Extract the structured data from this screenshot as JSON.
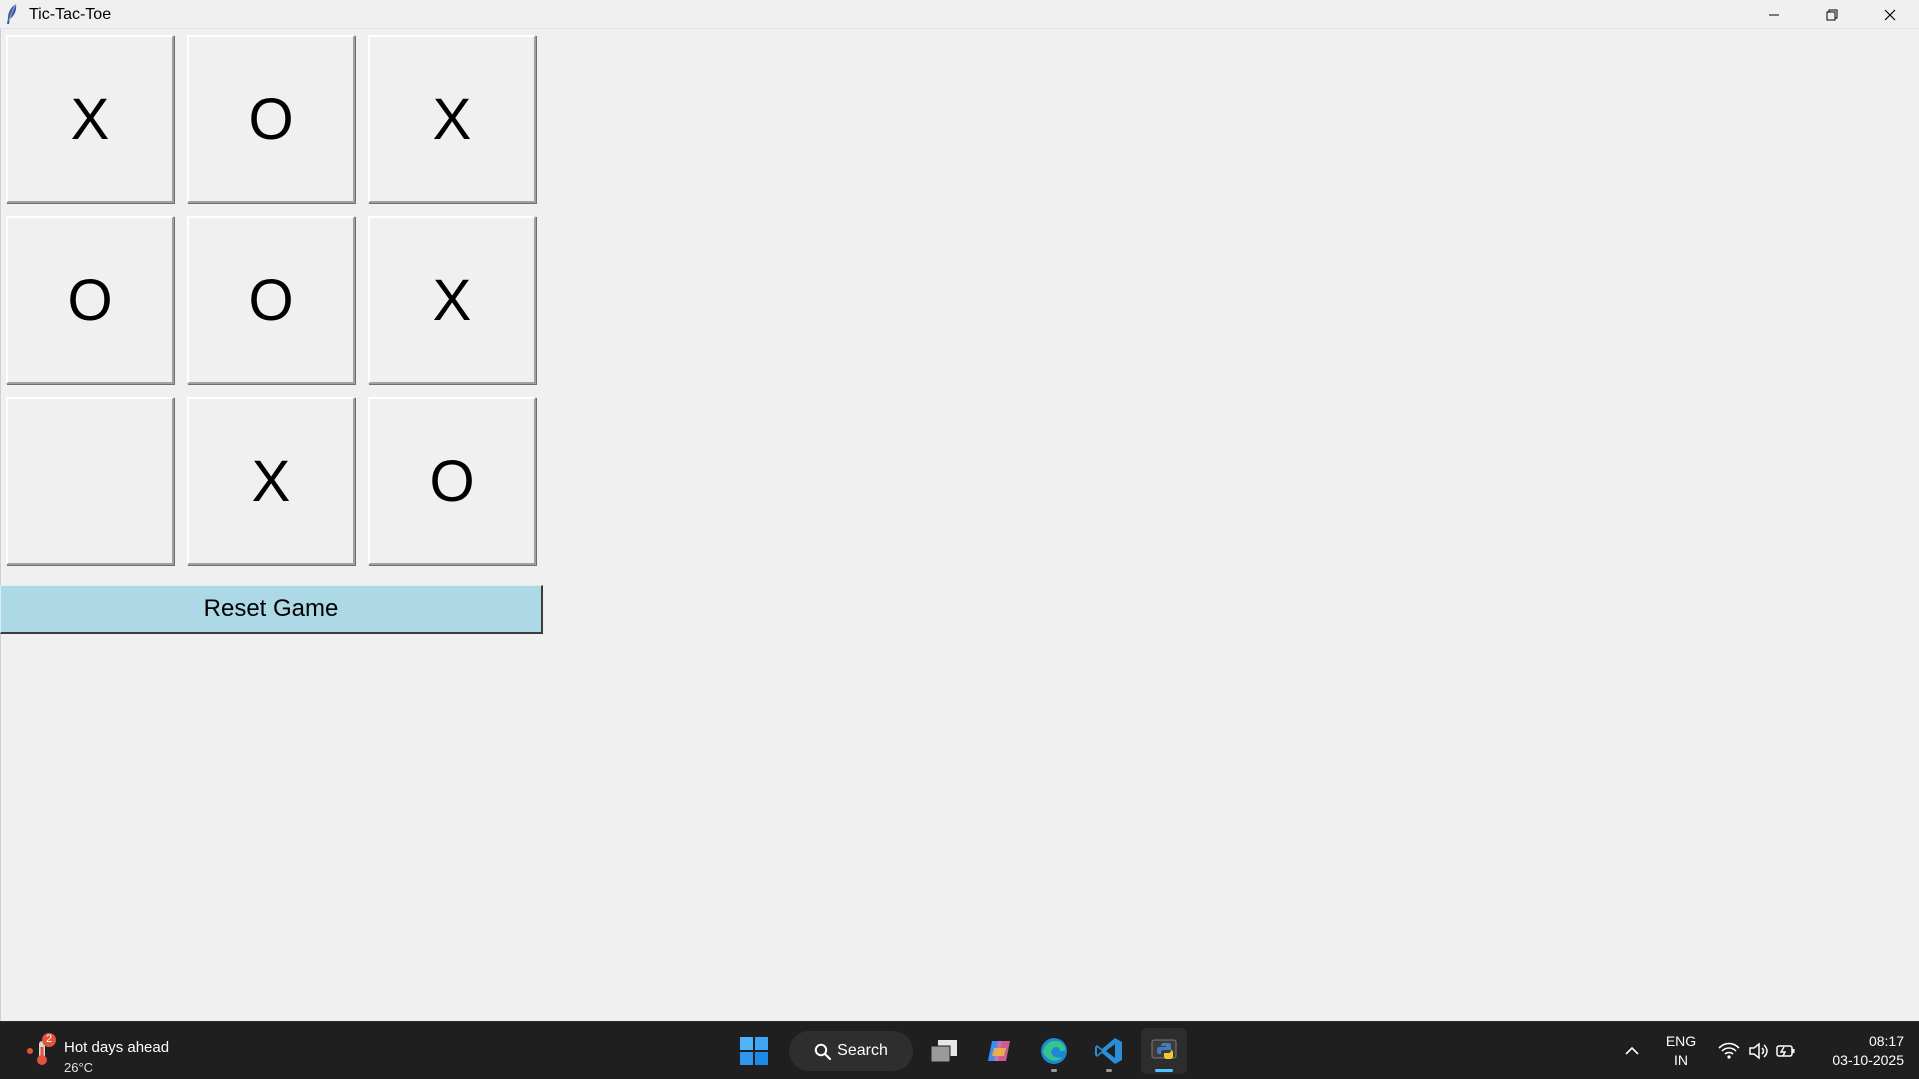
{
  "window": {
    "title": "Tic-Tac-Toe"
  },
  "board": {
    "cells": [
      "X",
      "O",
      "X",
      "O",
      "O",
      "X",
      "",
      "X",
      "O"
    ]
  },
  "reset_label": "Reset Game",
  "taskbar": {
    "weather": {
      "title": "Hot days ahead",
      "temperature": "26°C",
      "badge": "2"
    },
    "search_label": "Search",
    "language": {
      "line1": "ENG",
      "line2": "IN"
    },
    "clock": {
      "time": "08:17",
      "date": "03-10-2025"
    }
  },
  "colors": {
    "window_bg": "#f0f0f0",
    "reset_bg": "#add8e6",
    "taskbar_bg": "#1f1f1f",
    "accent": "#4cc2ff"
  },
  "icons": {
    "app": "feather-icon",
    "minimize": "minimize-icon",
    "restore": "restore-icon",
    "close": "close-icon",
    "start": "windows-start-icon",
    "search": "search-icon",
    "task_view": "task-view-icon",
    "copilot": "copilot-icon",
    "edge": "edge-icon",
    "vscode": "vscode-icon",
    "python": "python-icon",
    "tray_overflow": "chevron-up-icon",
    "wifi": "wifi-icon",
    "volume": "volume-icon",
    "battery": "battery-icon"
  }
}
